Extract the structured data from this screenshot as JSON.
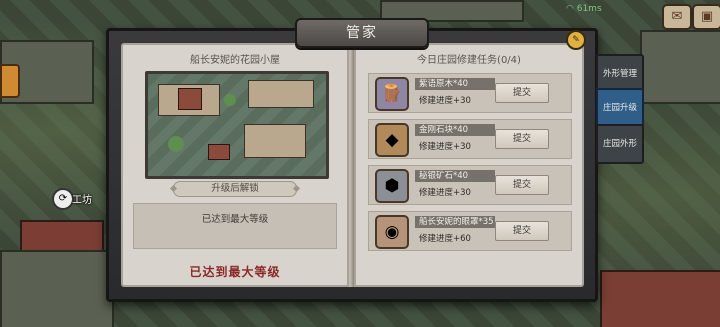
{
  "window": {
    "title": "管家"
  },
  "hud": {
    "wifi": "61ms"
  },
  "background": {
    "building_label": "工坊"
  },
  "left_page": {
    "title": "船长安妮的花园小屋",
    "unlock_header": "升级后解锁",
    "unlock_text": "已达到最大等级",
    "footer_status": "已达到最大等级"
  },
  "right_page": {
    "title": "今日庄园修建任务(0/4)",
    "tasks": [
      {
        "name": "紫语原木*40",
        "progress": "修建进度+30",
        "button": "提交",
        "icon": "log-icon"
      },
      {
        "name": "金刚石块*40",
        "progress": "修建进度+30",
        "button": "提交",
        "icon": "crystal-icon"
      },
      {
        "name": "秘银矿石*40",
        "progress": "修建进度+30",
        "button": "提交",
        "icon": "ore-icon"
      },
      {
        "name": "船长安妮的眼罩*35",
        "progress": "修建进度+60",
        "button": "提交",
        "icon": "eyepatch-icon"
      }
    ]
  },
  "side_tabs": [
    {
      "label": "外形管理",
      "active": false
    },
    {
      "label": "庄园升级",
      "active": true
    },
    {
      "label": "庄园外形",
      "active": false
    }
  ]
}
